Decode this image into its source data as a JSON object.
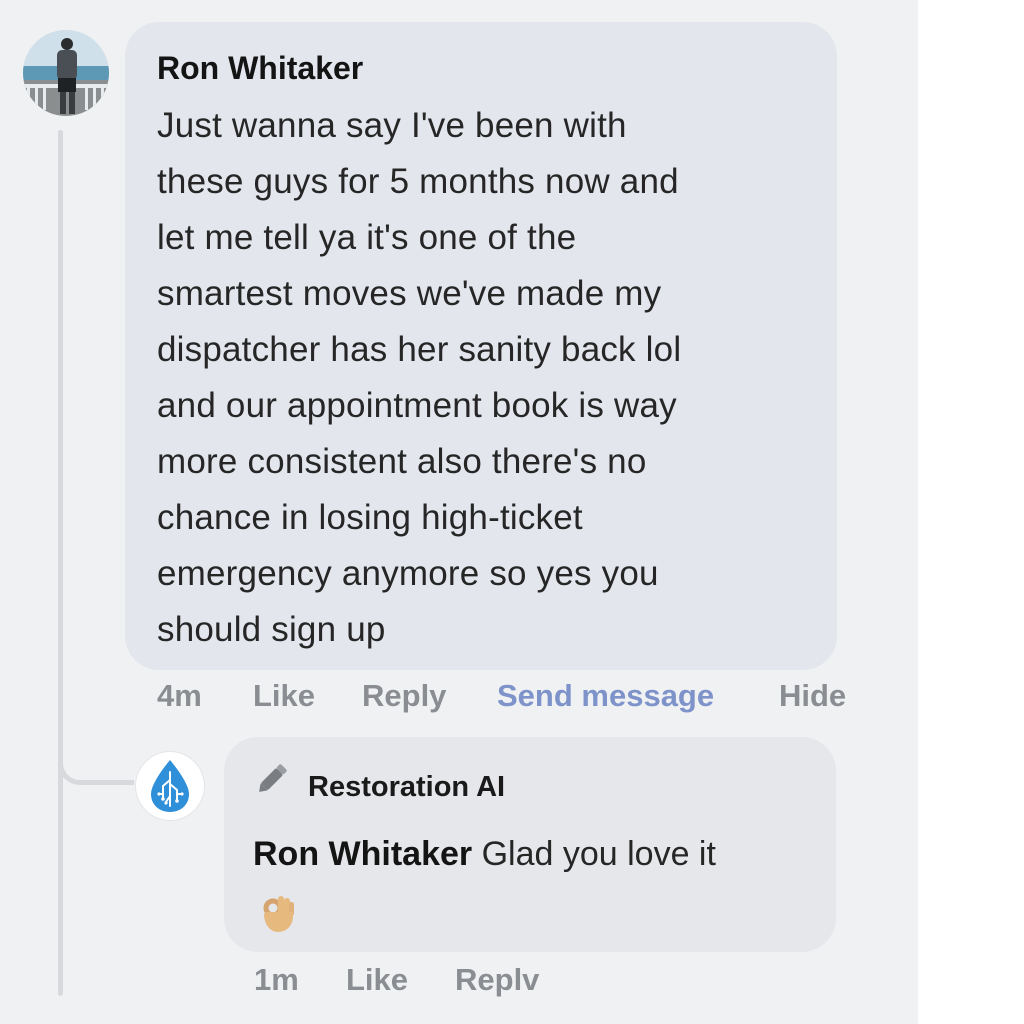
{
  "comment": {
    "author": "Ron Whitaker",
    "lines": [
      "Just wanna say I've been with",
      "these guys for 5 months now and",
      "let me tell ya it's one of the",
      "smartest moves we've made my",
      "dispatcher has her sanity back lol",
      "and our appointment book is way",
      "more consistent also there's no",
      "chance in losing high-ticket",
      "emergency anymore so yes you",
      "should sign up"
    ],
    "actions": {
      "time": "4m",
      "like": "Like",
      "reply": "Reply",
      "send_message": "Send message",
      "hide": "Hide"
    }
  },
  "reply": {
    "page_name": "Restoration AI",
    "mention": "Ron Whitaker",
    "text": " Glad you love it",
    "emoji": "ok-hand-emoji",
    "actions": {
      "time": "1m",
      "like": "Like",
      "reply": "Replv"
    }
  },
  "colors": {
    "bubble_main": "#e3e6ed",
    "bubble_reply": "#e6e7ea",
    "action_gray": "#8a8d92",
    "send_message_blue": "#7d93c9",
    "logo_blue": "#2f8fd8"
  }
}
